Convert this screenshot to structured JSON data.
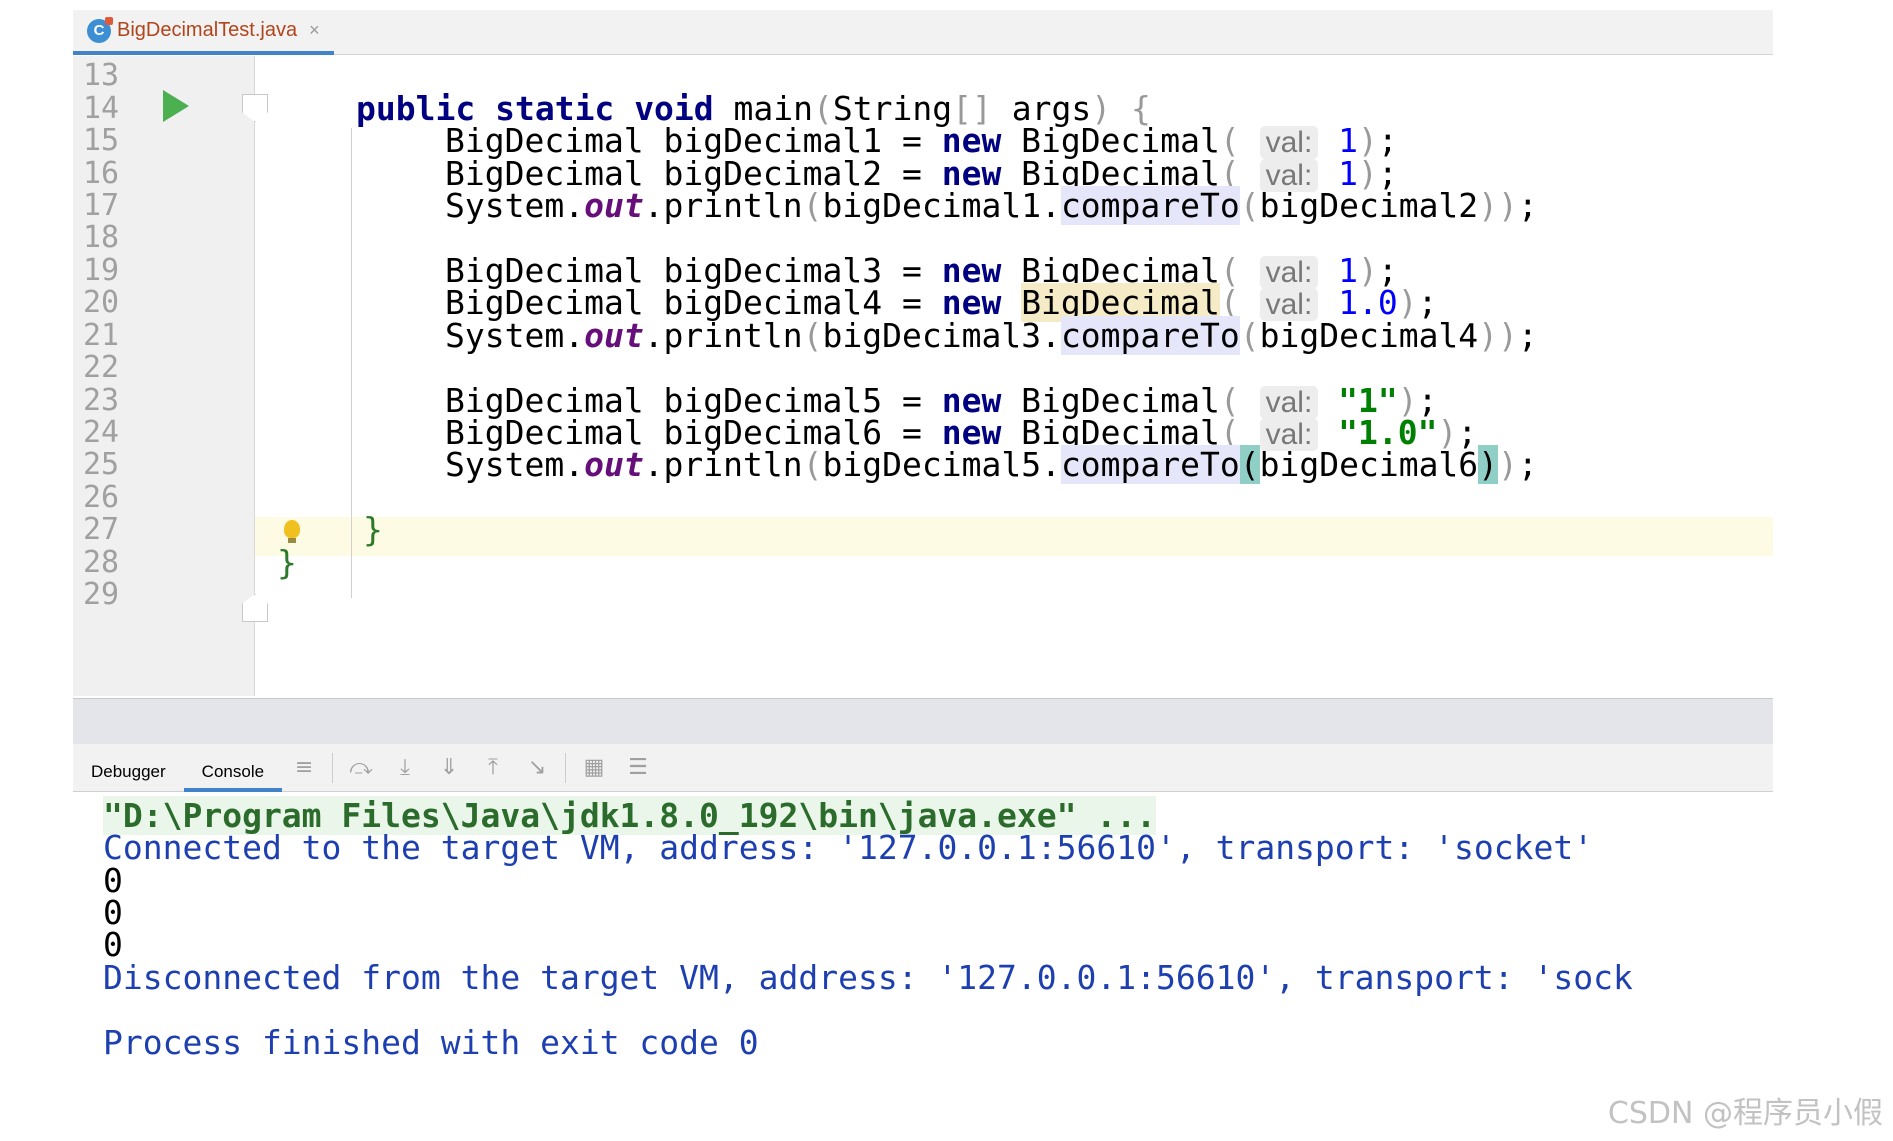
{
  "tab": {
    "file_icon_letter": "C",
    "filename": "BigDecimalTest.java",
    "close_glyph": "×"
  },
  "editor": {
    "line_numbers": [
      "13",
      "14",
      "15",
      "16",
      "17",
      "18",
      "19",
      "20",
      "21",
      "22",
      "23",
      "24",
      "25",
      "26",
      "27",
      "28",
      "29"
    ],
    "code": {
      "l14_public": "public",
      "l14_static": "static",
      "l14_void": "void",
      "l14_main": " main",
      "l14_open": "(",
      "l14_type": "String",
      "l14_arr": "[]",
      "l14_args": " args",
      "l14_close": ")",
      "l14_brace": " {",
      "bd_type": "BigDecimal",
      "var1": " bigDecimal1 = ",
      "var2": " bigDecimal2 = ",
      "var3": " bigDecimal3 = ",
      "var4": " bigDecimal4 = ",
      "var5": " bigDecimal5 = ",
      "var6": " bigDecimal6 = ",
      "kw_new": "new",
      "ctor": " BigDecimal",
      "ctor_plain": "BigDecimal",
      "paren_open": "(",
      "paren_close": ")",
      "semi": ";",
      "hint_label": "val:",
      "num_1": "1",
      "num_1_0": "1.0",
      "str_1": "\"1\"",
      "str_1_0": "\"1.0\"",
      "sys": "System.",
      "out": "out",
      "println": ".println",
      "arg1": "bigDecimal1.",
      "arg3": "bigDecimal3.",
      "arg5": "bigDecimal5.",
      "compareTo": "compareTo",
      "cmp2": "bigDecimal2",
      "cmp4": "bigDecimal4",
      "cmp6": "bigDecimal6",
      "close2": "))",
      "close1": ")",
      "end_main": "}",
      "end_class": "}"
    }
  },
  "panel": {
    "tabs": [
      "Debugger",
      "Console"
    ],
    "active_tab": "Console"
  },
  "console": {
    "lines": [
      "\"D:\\Program Files\\Java\\jdk1.8.0_192\\bin\\java.exe\" ...",
      "Connected to the target VM, address: '127.0.0.1:56610', transport: 'socket'",
      "0",
      "0",
      "0",
      "Disconnected from the target VM, address: '127.0.0.1:56610', transport: 'sock",
      "Process finished with exit code 0"
    ]
  },
  "watermark": "CSDN @程序员小假"
}
